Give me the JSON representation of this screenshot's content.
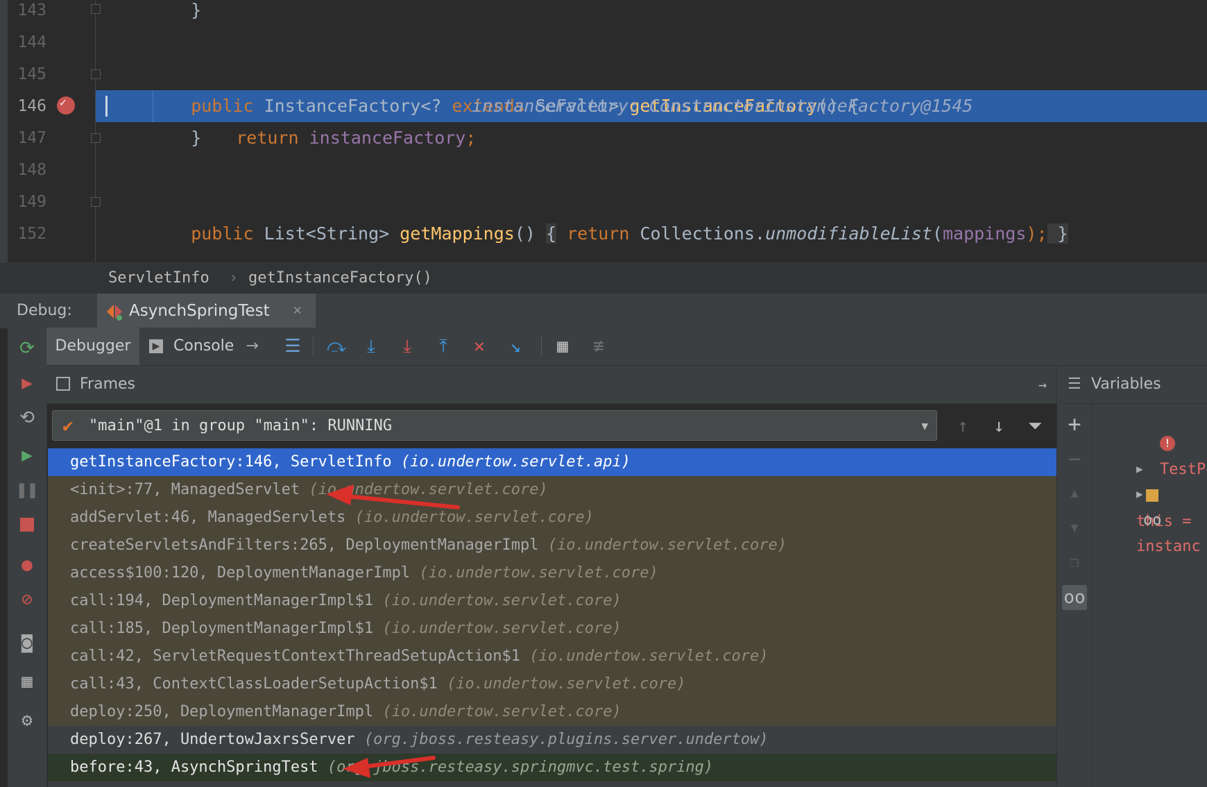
{
  "editor": {
    "lines": [
      {
        "num": "143",
        "code": "    }"
      },
      {
        "num": "144",
        "code": ""
      },
      {
        "num": "145",
        "code_parts": [
          "public",
          " InstanceFactory<? ",
          "extends",
          " Servlet> ",
          "getInstanceFactory",
          "() {"
        ]
      },
      {
        "num": "146",
        "code_parts": [
          "return",
          " ",
          "instanceFactory",
          ";"
        ],
        "inline_value": "instanceFactory: ConstructorInstanceFactory@1545"
      },
      {
        "num": "147",
        "code": "    }"
      },
      {
        "num": "148",
        "code": ""
      },
      {
        "num": "149",
        "code_parts": [
          "public",
          " List<String> ",
          "getMappings",
          "() ",
          "{",
          " return",
          " Collections.",
          "unmodifiableList",
          "(",
          "mappings",
          ");",
          " }"
        ]
      },
      {
        "num": "152",
        "code": ""
      }
    ]
  },
  "breadcrumb": {
    "class_name": "ServletInfo",
    "separator": "›",
    "method": "getInstanceFactory()"
  },
  "debug": {
    "label": "Debug:",
    "run_config": "AsynchSpringTest",
    "close_glyph": "×",
    "tabs": {
      "debugger": "Debugger",
      "console": "Console"
    }
  },
  "frames": {
    "title": "Frames",
    "thread": "\"main\"@1 in group \"main\": RUNNING",
    "rows": [
      {
        "method": "getInstanceFactory:146, ServletInfo",
        "pkg": "(io.undertow.servlet.api)",
        "style": "selected"
      },
      {
        "method": "<init>:77, ManagedServlet",
        "pkg": "(io.undertow.servlet.core)",
        "style": "lib"
      },
      {
        "method": "addServlet:46, ManagedServlets",
        "pkg": "(io.undertow.servlet.core)",
        "style": "lib"
      },
      {
        "method": "createServletsAndFilters:265, DeploymentManagerImpl",
        "pkg": "(io.undertow.servlet.core)",
        "style": "lib"
      },
      {
        "method": "access$100:120, DeploymentManagerImpl",
        "pkg": "(io.undertow.servlet.core)",
        "style": "lib"
      },
      {
        "method": "call:194, DeploymentManagerImpl$1",
        "pkg": "(io.undertow.servlet.core)",
        "style": "lib"
      },
      {
        "method": "call:185, DeploymentManagerImpl$1",
        "pkg": "(io.undertow.servlet.core)",
        "style": "lib"
      },
      {
        "method": "call:42, ServletRequestContextThreadSetupAction$1",
        "pkg": "(io.undertow.servlet.core)",
        "style": "lib"
      },
      {
        "method": "call:43, ContextClassLoaderSetupAction$1",
        "pkg": "(io.undertow.servlet.core)",
        "style": "lib"
      },
      {
        "method": "deploy:250, DeploymentManagerImpl",
        "pkg": "(io.undertow.servlet.core)",
        "style": "lib"
      },
      {
        "method": "deploy:267, UndertowJaxrsServer",
        "pkg": "(org.jboss.resteasy.plugins.server.undertow)",
        "style": "normal"
      },
      {
        "method": "before:43, AsynchSpringTest",
        "pkg": "(org.jboss.resteasy.springmvc.test.spring)",
        "style": "green"
      }
    ]
  },
  "variables": {
    "title": "Variables",
    "items": [
      {
        "name": "TestPo",
        "icon": "error-icon"
      },
      {
        "name": "this =",
        "icon": "field-icon"
      },
      {
        "name": "instanc",
        "icon": "watch-icon"
      }
    ]
  },
  "colors": {
    "exec_line": "#2d5fa6",
    "selected_frame": "#2f65ca",
    "library_frame": "#4a4638",
    "arrow": "#d9302a"
  }
}
